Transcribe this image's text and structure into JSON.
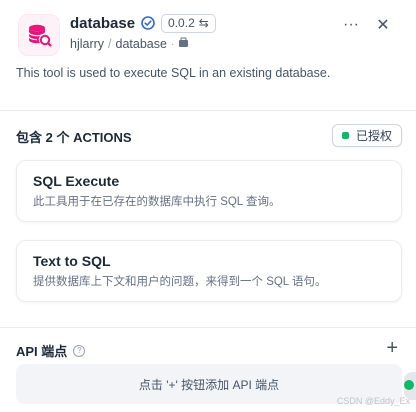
{
  "header": {
    "tool_name": "database",
    "version": "0.0.2",
    "author": "hjlarry",
    "separator": "/",
    "plugin_name": "database",
    "logo_icon": "database-search-icon",
    "accent_color": "#e9157a"
  },
  "description": "This tool is used to execute SQL in an existing database.",
  "actions_section": {
    "title": "包含 2 个 ACTIONS",
    "auth_label": "已授权",
    "auth_color": "#12b76a"
  },
  "actions": [
    {
      "title": "SQL Execute",
      "desc": "此工具用于在已存在的数据库中执行 SQL 查询。"
    },
    {
      "title": "Text to SQL",
      "desc": "提供数据库上下文和用户的问题，来得到一个 SQL 语句。"
    }
  ],
  "api_section": {
    "title": "API 端点",
    "add_hint": "点击 '+' 按钮添加 API 端点"
  },
  "watermark": "CSDN @Eddy_Ex"
}
